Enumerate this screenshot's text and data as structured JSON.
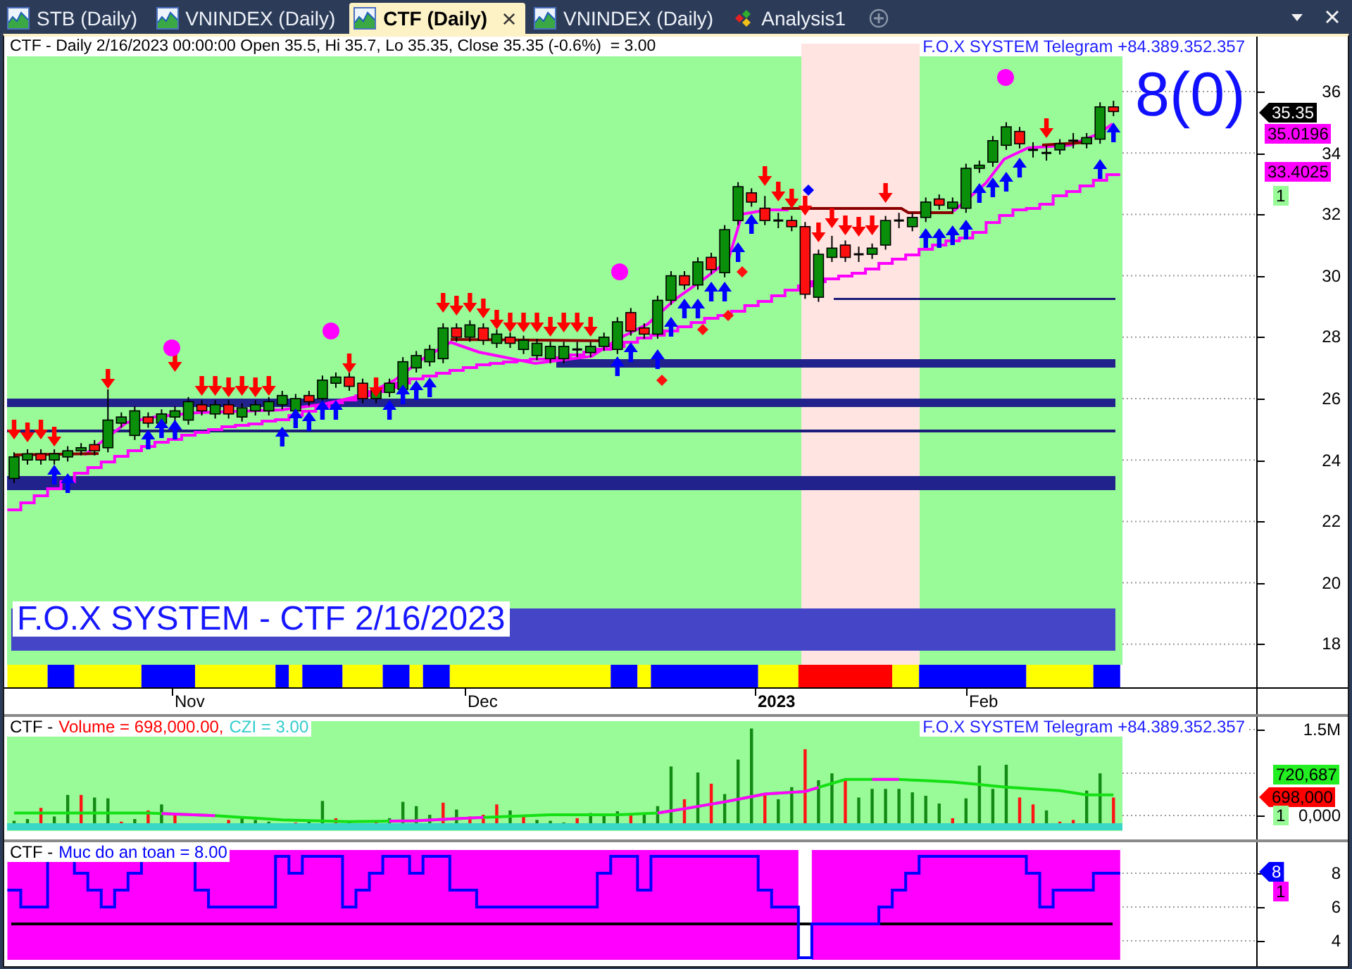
{
  "tabs": [
    {
      "label": "STB (Daily)",
      "kind": "chart",
      "selected": false
    },
    {
      "label": "VNINDEX (Daily)",
      "kind": "chart",
      "selected": false
    },
    {
      "label": "CTF (Daily)",
      "kind": "chart",
      "selected": true
    },
    {
      "label": "VNINDEX (Daily)",
      "kind": "chart",
      "selected": false
    },
    {
      "label": "Analysis1",
      "kind": "analysis",
      "selected": false
    }
  ],
  "price_panel": {
    "info": "CTF - Daily 2/16/2023 00:00:00 Open 35.5, Hi 35.7, Lo 35.35, Close 35.35 (-0.6%)  = 3.00",
    "caption": "F.O.X SYSTEM Telegram +84.389.352.357",
    "signal_count": "8(0)",
    "banner": "F.O.X SYSTEM - CTF 2/16/2023",
    "axis_ticks": [
      "36",
      "34",
      "32",
      "30",
      "28",
      "26",
      "24",
      "22",
      "20",
      "18"
    ],
    "value_labels": [
      {
        "text": "35.35",
        "kind": "pointer",
        "color": "#000000"
      },
      {
        "text": "35.0196",
        "kind": "box",
        "color": "#ff00ff"
      },
      {
        "text": "33.4025",
        "kind": "box",
        "color": "#ff00ff"
      },
      {
        "text": "1",
        "kind": "box",
        "color": "#98fb98"
      }
    ],
    "date_axis": [
      {
        "label": "Nov",
        "kind": "month"
      },
      {
        "label": "Dec",
        "kind": "month"
      },
      {
        "label": "2023",
        "kind": "year"
      },
      {
        "label": "Feb",
        "kind": "month"
      }
    ]
  },
  "volume_panel": {
    "title": [
      {
        "text": "CTF -",
        "color": "#000000"
      },
      {
        "text": "Volume = 698,000.00,",
        "color": "#ff0000"
      },
      {
        "text": "CZI = 3.00",
        "color": "#33cccc"
      }
    ],
    "caption": "F.O.X SYSTEM Telegram +84.389.352.357",
    "axis_ticks": [
      "1.5M",
      "0,000"
    ],
    "value_labels": [
      {
        "text": "720,687",
        "kind": "box",
        "color": "#22ee22"
      },
      {
        "text": "698,000",
        "kind": "pointer",
        "color": "#ff0000"
      },
      {
        "text": "1",
        "kind": "box",
        "color": "#98fb98"
      }
    ]
  },
  "indicator_panel": {
    "title": [
      {
        "text": "CTF -",
        "color": "#000000"
      },
      {
        "text": "Muc do an toan = 8.00",
        "color": "#0000ff"
      }
    ],
    "axis_ticks": [
      "8",
      "6",
      "4"
    ],
    "value_labels": [
      {
        "text": "8",
        "kind": "pointer",
        "color": "#0000ff"
      },
      {
        "text": "1",
        "kind": "box",
        "color": "#ff00ff"
      }
    ]
  }
}
